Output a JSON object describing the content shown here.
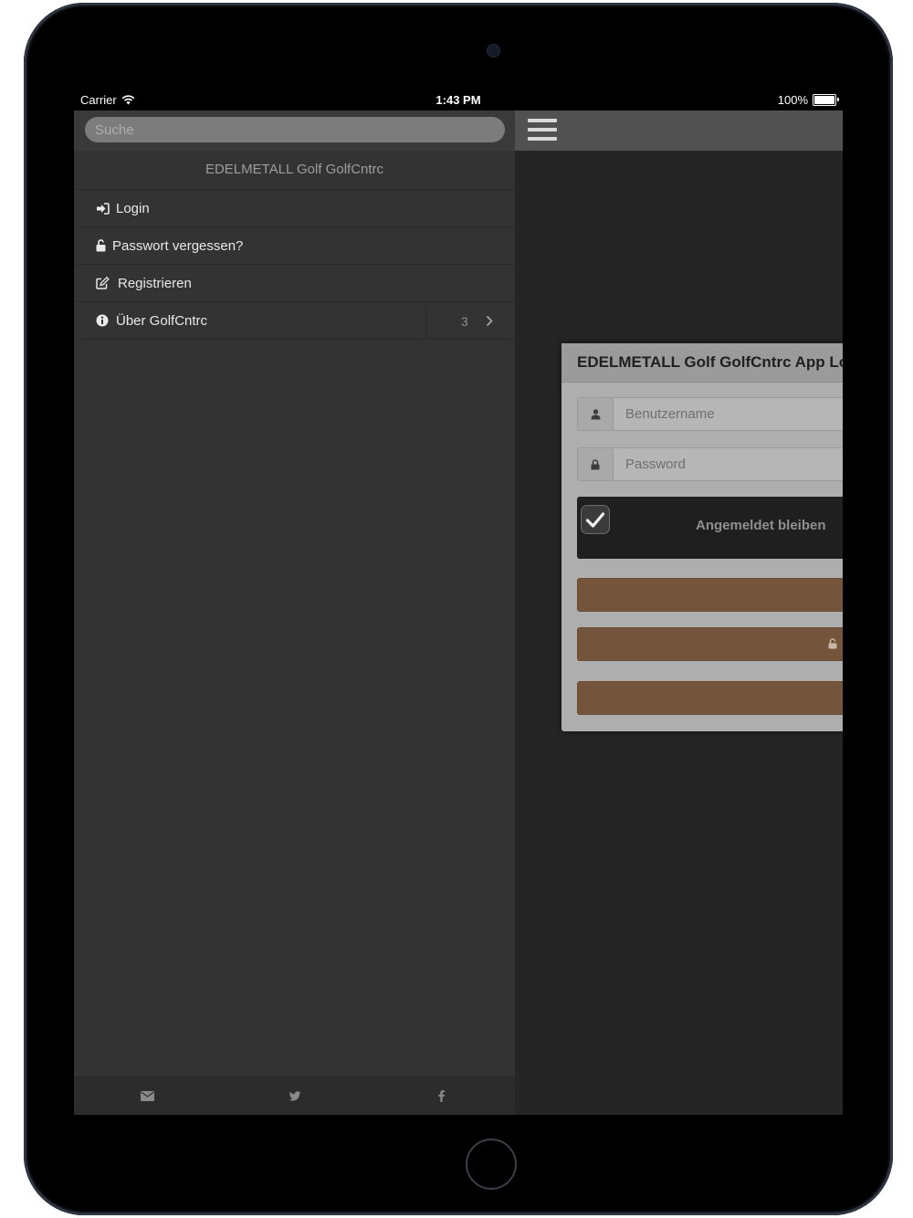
{
  "status_bar": {
    "carrier": "Carrier",
    "time": "1:43 PM",
    "battery": "100%"
  },
  "side_panel": {
    "search_placeholder": "Suche",
    "title": "EDELMETALL Golf GolfCntrc",
    "items": [
      {
        "label": "Login",
        "icon": "sign-in-icon"
      },
      {
        "label": "Passwort vergessen?",
        "icon": "unlock-icon"
      },
      {
        "label": "Registrieren",
        "icon": "edit-icon"
      },
      {
        "label": "Über GolfCntrc",
        "icon": "info-icon",
        "count": "3"
      }
    ],
    "footer_icons": [
      "envelope-icon",
      "twitter-icon",
      "facebook-icon"
    ]
  },
  "main": {
    "menu_icon": "hamburger-icon",
    "dialog": {
      "title": "EDELMETALL Golf GolfCntrc App Lo",
      "username_placeholder": "Benutzername",
      "password_placeholder": "Password",
      "remember_label": "Angemeldet bleiben",
      "remember_checked": true
    }
  },
  "colors": {
    "accent_brown": "#74543a",
    "panel_bg": "#333333",
    "page_bg": "#252525"
  }
}
